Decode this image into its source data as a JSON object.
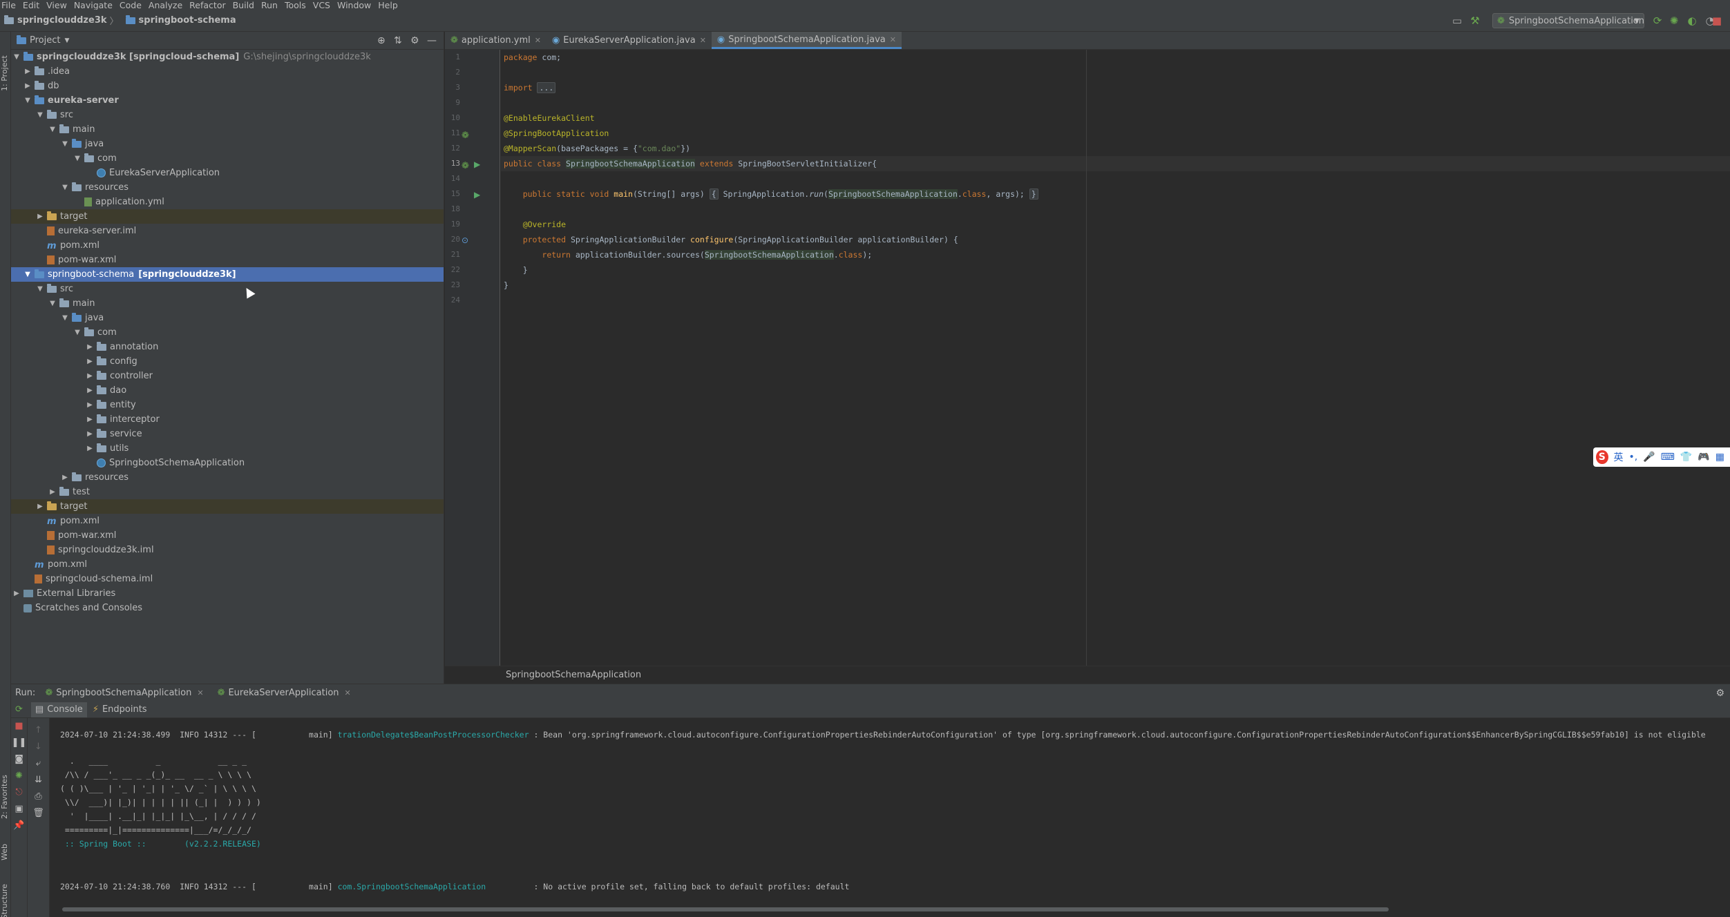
{
  "menu": [
    "File",
    "Edit",
    "View",
    "Navigate",
    "Code",
    "Analyze",
    "Refactor",
    "Build",
    "Run",
    "Tools",
    "VCS",
    "Window",
    "Help"
  ],
  "breadcrumb": [
    "springclouddze3k",
    "springboot-schema"
  ],
  "run_config": "SpringbootSchemaApplication",
  "left_strip": {
    "project": "1: Project",
    "favorites": "2: Favorites",
    "web": "Web",
    "structure": "Z: Structure"
  },
  "project_panel": {
    "title": "Project",
    "tree": [
      {
        "label": "springclouddze3k [springcloud-schema]",
        "extra": "G:\\shejing\\springclouddze3k"
      },
      {
        "label": ".idea"
      },
      {
        "label": "db"
      },
      {
        "label": "eureka-server"
      },
      {
        "label": "src"
      },
      {
        "label": "main"
      },
      {
        "label": "java"
      },
      {
        "label": "com"
      },
      {
        "label": "EurekaServerApplication"
      },
      {
        "label": "resources"
      },
      {
        "label": "application.yml"
      },
      {
        "label": "target"
      },
      {
        "label": "eureka-server.iml"
      },
      {
        "label": "pom.xml"
      },
      {
        "label": "pom-war.xml"
      },
      {
        "label": "springboot-schema",
        "extra": "[springclouddze3k]"
      },
      {
        "label": "src"
      },
      {
        "label": "main"
      },
      {
        "label": "java"
      },
      {
        "label": "com"
      },
      {
        "label": "annotation"
      },
      {
        "label": "config"
      },
      {
        "label": "controller"
      },
      {
        "label": "dao"
      },
      {
        "label": "entity"
      },
      {
        "label": "interceptor"
      },
      {
        "label": "service"
      },
      {
        "label": "utils"
      },
      {
        "label": "SpringbootSchemaApplication"
      },
      {
        "label": "resources"
      },
      {
        "label": "test"
      },
      {
        "label": "target"
      },
      {
        "label": "pom.xml"
      },
      {
        "label": "pom-war.xml"
      },
      {
        "label": "springclouddze3k.iml"
      },
      {
        "label": "pom.xml"
      },
      {
        "label": "springcloud-schema.iml"
      },
      {
        "label": "External Libraries"
      },
      {
        "label": "Scratches and Consoles"
      }
    ]
  },
  "editor": {
    "tabs": [
      "application.yml",
      "EurekaServerApplication.java",
      "SpringbootSchemaApplication.java"
    ],
    "active_tab": "SpringbootSchemaApplication.java",
    "line_numbers": [
      "1",
      "2",
      "3",
      "9",
      "10",
      "11",
      "12",
      "13",
      "14",
      "15",
      "18",
      "19",
      "20",
      "21",
      "22",
      "23",
      "24"
    ],
    "footer": "SpringbootSchemaApplication"
  },
  "ime": {
    "lang": "英",
    "punct": "•,"
  },
  "run_panel": {
    "label": "Run:",
    "tabs": [
      "SpringbootSchemaApplication",
      "EurekaServerApplication"
    ],
    "subtabs": [
      "Console",
      "Endpoints"
    ],
    "log1": {
      "prefix": "2024-07-10 21:24:38.499  INFO 14312 --- [           main] ",
      "logger": "trationDelegate$BeanPostProcessorChecker",
      "msg": " : Bean 'org.springframework.cloud.autoconfigure.ConfigurationPropertiesRebinderAutoConfiguration' of type [org.springframework.cloud.autoconfigure.ConfigurationPropertiesRebinderAutoConfiguration$$EnhancerBySpringCGLIB$$e59fab10] is not eligible"
    },
    "banner": [
      "  .   ____          _            __ _ _",
      " /\\\\ / ___'_ __ _ _(_)_ __  __ _ \\ \\ \\ \\",
      "( ( )\\___ | '_ | '_| | '_ \\/ _` | \\ \\ \\ \\",
      " \\\\/  ___)| |_)| | | | | || (_| |  ) ) ) )",
      "  '  |____| .__|_| |_|_| |_\\__, | / / / /",
      " =========|_|==============|___/=/_/_/_/",
      " :: Spring Boot ::        (v2.2.2.RELEASE)"
    ],
    "log2": {
      "prefix": "2024-07-10 21:24:38.760  INFO 14312 --- [           main] ",
      "logger": "com.SpringbootSchemaApplication",
      "msg": "          : No active profile set, falling back to default profiles: default"
    }
  }
}
